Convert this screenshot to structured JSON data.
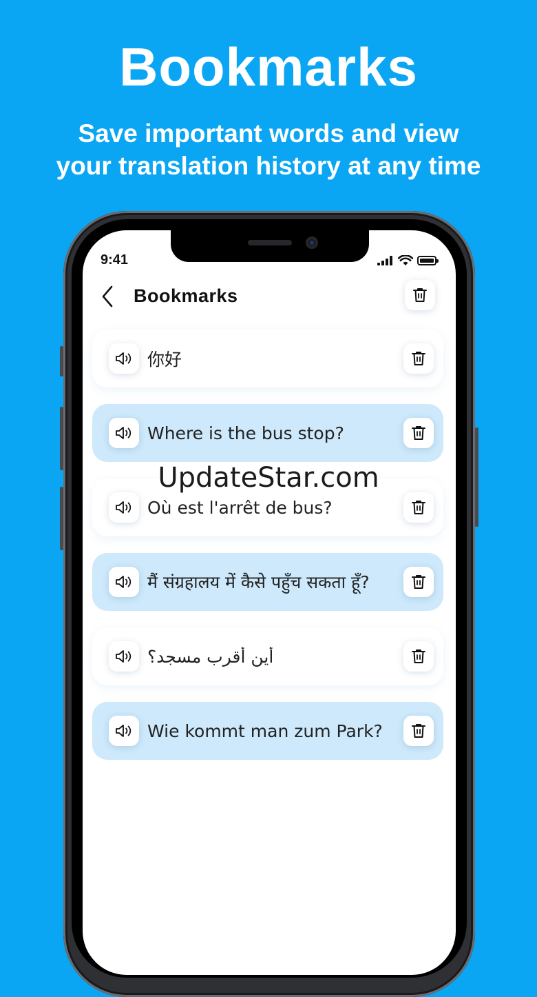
{
  "promo": {
    "title": "Bookmarks",
    "subtitle_line1": "Save important words and view",
    "subtitle_line2": "your translation history at any time"
  },
  "status_bar": {
    "time": "9:41"
  },
  "header": {
    "title": "Bookmarks"
  },
  "bookmarks": [
    {
      "text": "你好",
      "highlighted": false
    },
    {
      "text": "Where is the bus stop?",
      "highlighted": true
    },
    {
      "text": "Où est l'arrêt de bus?",
      "highlighted": false
    },
    {
      "text": "मैं संग्रहालय में कैसे पहुँच सकता हूँ?",
      "highlighted": true
    },
    {
      "text": "أين أقرب مسجد؟",
      "highlighted": false
    },
    {
      "text": "Wie kommt man zum Park?",
      "highlighted": true
    }
  ],
  "watermark": "UpdateStar.com",
  "colors": {
    "background": "#0aa6f4",
    "highlight_card": "#cde9fb"
  },
  "icons": {
    "back": "chevron-left-icon",
    "speaker": "speaker-icon",
    "delete": "trash-icon"
  }
}
